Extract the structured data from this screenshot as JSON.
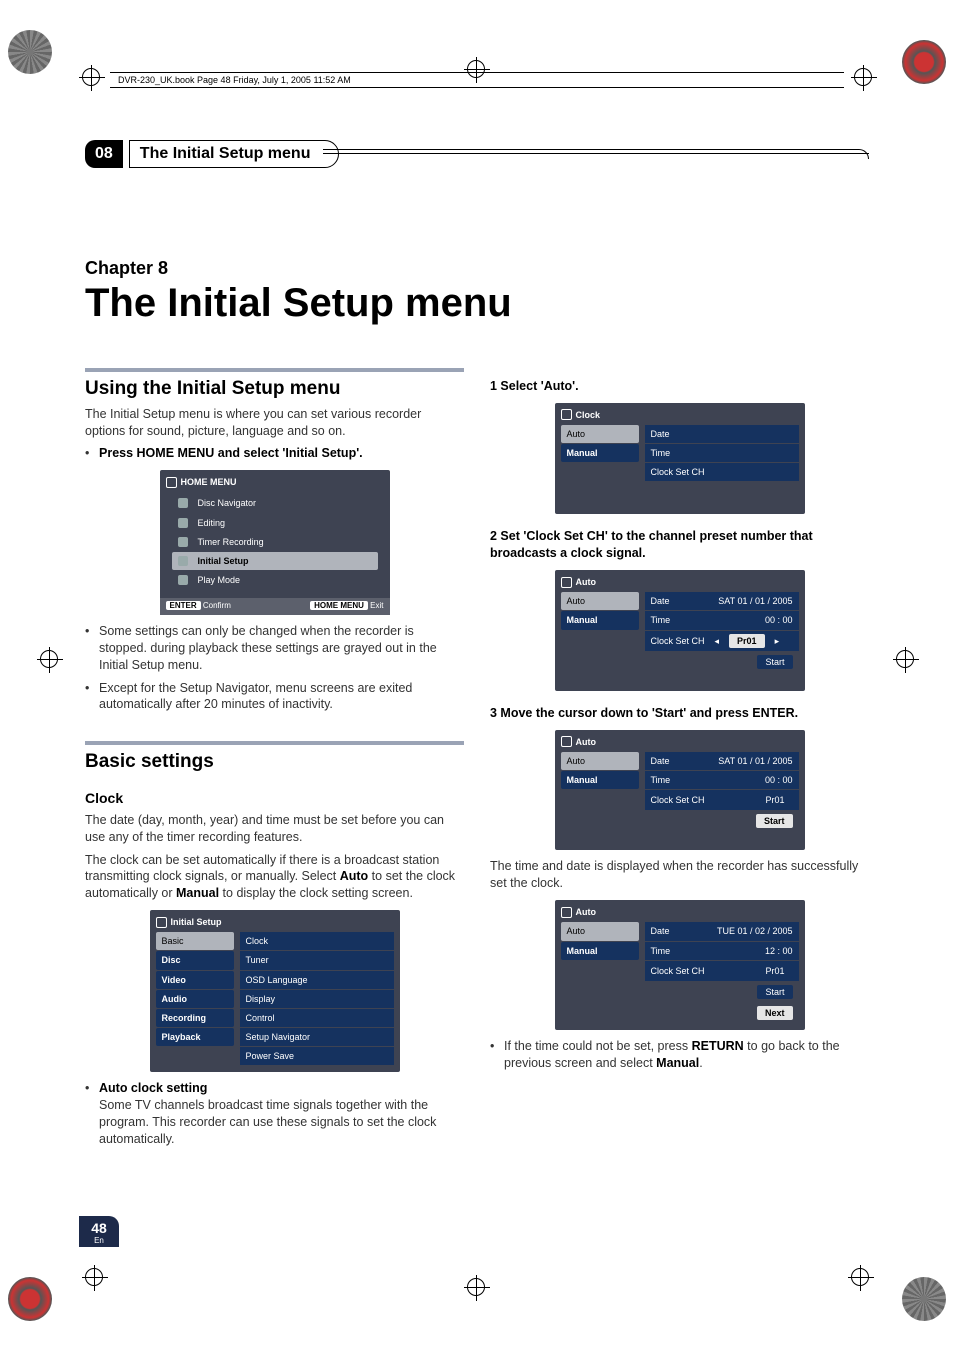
{
  "book_header": "DVR-230_UK.book  Page 48  Friday, July 1, 2005  11:52 AM",
  "section": {
    "num": "08",
    "title": "The Initial Setup menu"
  },
  "chapter": {
    "label": "Chapter 8",
    "title": "The Initial Setup menu"
  },
  "page_number": "48",
  "page_lang": "En",
  "left": {
    "h2_using": "Using the Initial Setup menu",
    "using_para": "The Initial Setup menu is where you can set various recorder options for sound, picture, language and so on.",
    "press_bullet": "Press HOME MENU and select 'Initial Setup'.",
    "note1": "Some settings can only be changed when the recorder is stopped. during playback these settings are grayed out in the Initial Setup menu.",
    "note2": "Except for the Setup Navigator, menu screens are exited automatically after 20 minutes of inactivity.",
    "h2_basic": "Basic settings",
    "h3_clock": "Clock",
    "clock_para1": "The date (day, month, year) and time must be set before you can use any of the timer recording features.",
    "clock_para2_a": "The clock can be set automatically if there is a broadcast station transmitting clock signals, or manually. Select ",
    "clock_para2_b": " to set the clock automatically or ",
    "clock_para2_c": " to display the clock setting screen.",
    "auto_word": "Auto",
    "manual_word": "Manual",
    "auto_clock_heading": "Auto clock setting",
    "auto_clock_para": "Some TV channels broadcast time signals together with the program. This recorder can use these signals to set the clock automatically."
  },
  "right": {
    "step1": "1    Select 'Auto'.",
    "step2": "2    Set 'Clock Set CH' to the channel preset number that broadcasts a clock signal.",
    "step3": "3    Move the cursor down to 'Start' and press ENTER.",
    "success_para": "The time and date is displayed when the recorder has successfully set the clock.",
    "return_bullet_a": "If the time could not be set, press ",
    "return_bullet_b": " to go back to the previous screen and select ",
    "return_bullet_c": ".",
    "return_word": "RETURN",
    "manual_word": "Manual"
  },
  "osd": {
    "home": {
      "title": "HOME MENU",
      "items": [
        "Disc Navigator",
        "Editing",
        "Timer Recording",
        "Initial Setup",
        "Play Mode"
      ],
      "footer_confirm": "Confirm",
      "footer_exit": "Exit",
      "enter_btn": "ENTER",
      "homemenu_btn": "HOME MENU"
    },
    "initial_setup": {
      "title": "Initial Setup",
      "left": [
        "Basic",
        "Disc",
        "Video",
        "Audio",
        "Recording",
        "Playback"
      ],
      "right": [
        "Clock",
        "Tuner",
        "OSD Language",
        "Display",
        "Control",
        "Setup Navigator",
        "Power Save"
      ]
    },
    "clock1": {
      "title": "Clock",
      "left": [
        "Auto",
        "Manual"
      ],
      "right": [
        "Date",
        "Time",
        "Clock Set CH"
      ]
    },
    "auto2": {
      "title": "Auto",
      "left": [
        "Auto",
        "Manual"
      ],
      "labels": [
        "Date",
        "Time",
        "Clock Set CH"
      ],
      "date": "SAT  01  /  01  /  2005",
      "time": "00  :  00",
      "ch": "Pr01",
      "start": "Start"
    },
    "auto3": {
      "title": "Auto",
      "left": [
        "Auto",
        "Manual"
      ],
      "labels": [
        "Date",
        "Time",
        "Clock Set CH"
      ],
      "date": "SAT  01  /  01  /  2005",
      "time": "00  :  00",
      "ch": "Pr01",
      "start": "Start"
    },
    "auto4": {
      "title": "Auto",
      "left": [
        "Auto",
        "Manual"
      ],
      "labels": [
        "Date",
        "Time",
        "Clock Set CH"
      ],
      "date": "TUE  01  /  02  /  2005",
      "time": "12  :  00",
      "ch": "Pr01",
      "start": "Start",
      "next": "Next"
    }
  }
}
